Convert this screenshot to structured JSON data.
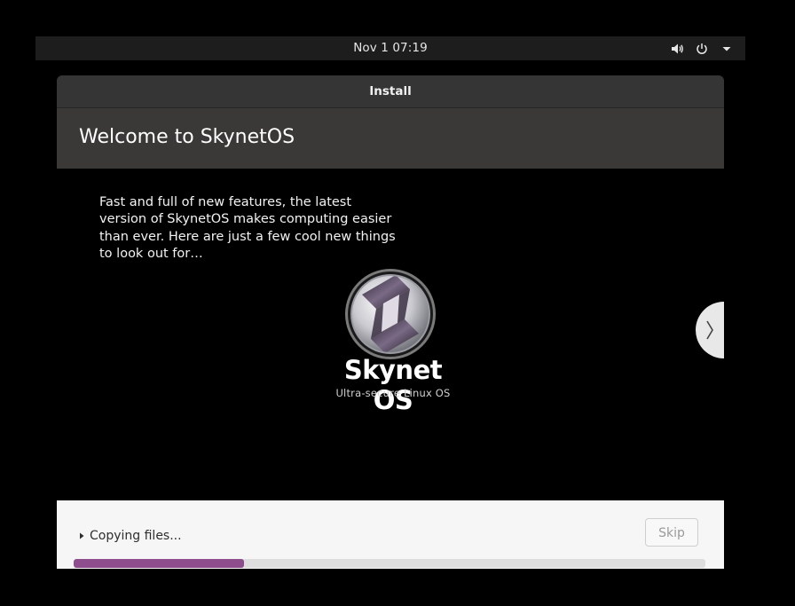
{
  "topbar": {
    "clock": "Nov 1  07:19",
    "icons": [
      "volume-icon",
      "power-icon",
      "caret-down-icon"
    ]
  },
  "window": {
    "title": "Install"
  },
  "header": {
    "title": "Welcome to SkynetOS"
  },
  "slide": {
    "intro": "Fast and full of new features, the latest version of SkynetOS makes computing easier than ever. Here are just a few cool new things to look out for…",
    "logo": {
      "brand": "Skynet OS",
      "tagline": "Ultra-secure Linux OS"
    },
    "next_icon": "chevron-right-icon"
  },
  "footer": {
    "status": "Copying files...",
    "skip_label": "Skip",
    "progress_fraction": 0.27
  },
  "colors": {
    "accent": "#8e4d8c",
    "header_bg": "#3a3937",
    "titlebar_bg": "#353535",
    "topbar_bg": "#1d1d1d"
  }
}
